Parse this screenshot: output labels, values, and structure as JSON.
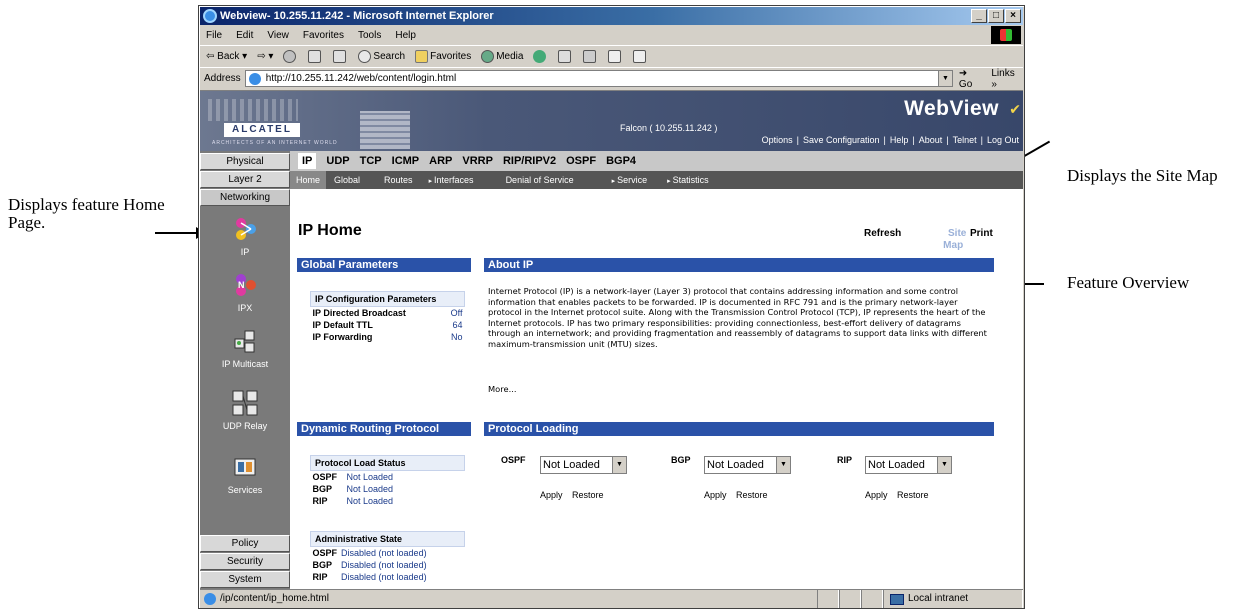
{
  "annotations": {
    "home_page": "Displays feature Home Page.",
    "site_map": "Displays the Site Map",
    "feature_overview": "Feature Overview"
  },
  "browser": {
    "title": "Webview- 10.255.11.242 - Microsoft Internet Explorer",
    "menu": [
      "File",
      "Edit",
      "View",
      "Favorites",
      "Tools",
      "Help"
    ],
    "toolbar": {
      "back": "Back",
      "search": "Search",
      "favorites": "Favorites",
      "media": "Media"
    },
    "address_label": "Address",
    "url": "http://10.255.11.242/web/content/login.html",
    "go": "Go",
    "links": "Links",
    "status_url": "/ip/content/ip_home.html",
    "status_zone": "Local intranet"
  },
  "banner": {
    "logo": "ALCATEL",
    "tagline": "ARCHITECTS OF AN INTERNET WORLD",
    "device": "Falcon  ( 10.255.11.242 )",
    "brand": "WebView",
    "links": [
      "Options",
      "Save Configuration",
      "Help",
      "About",
      "Telnet",
      "Log Out"
    ]
  },
  "leftnav": {
    "top_buttons": [
      "Physical",
      "Layer 2",
      "Networking"
    ],
    "items": [
      {
        "label": "IP",
        "icon": "ip-icon"
      },
      {
        "label": "IPX",
        "icon": "ipx-icon"
      },
      {
        "label": "IP Multicast",
        "icon": "ip-multicast-icon"
      },
      {
        "label": "UDP Relay",
        "icon": "udp-relay-icon"
      },
      {
        "label": "Services",
        "icon": "services-icon"
      }
    ],
    "bottom_buttons": [
      "Policy",
      "Security",
      "System"
    ]
  },
  "tabs": [
    "IP",
    "UDP",
    "TCP",
    "ICMP",
    "ARP",
    "VRRP",
    "RIP/RIPV2",
    "OSPF",
    "BGP4"
  ],
  "subnav": [
    "Home",
    "Global",
    "Routes",
    "Interfaces",
    "Denial of Service",
    "Service",
    "Statistics"
  ],
  "page": {
    "title": "IP Home",
    "refresh": "Refresh",
    "site_map": "Site Map",
    "site_label_1": "Site",
    "site_label_2": "Map",
    "print": "Print"
  },
  "global_parameters": {
    "header": "Global Parameters",
    "table_title": "IP Configuration Parameters",
    "rows": [
      {
        "label": "IP Directed Broadcast",
        "value": "Off"
      },
      {
        "label": "IP Default TTL",
        "value": "64"
      },
      {
        "label": "IP Forwarding",
        "value": "No"
      }
    ]
  },
  "about": {
    "header": "About IP",
    "text": "Internet Protocol (IP) is a network-layer (Layer 3) protocol that contains addressing information and some control information that enables packets to be forwarded. IP is documented in RFC 791 and is the primary network-layer protocol in the Internet protocol suite. Along with the Transmission Control Protocol (TCP), IP represents the heart of the Internet protocols. IP has two primary responsibilities: providing connectionless, best-effort delivery of datagrams through an internetwork; and providing fragmentation and reassembly of datagrams to support data links with different maximum-transmission unit (MTU) sizes.",
    "more": "More..."
  },
  "dynamic_routing": {
    "header": "Dynamic Routing Protocol",
    "load_status_title": "Protocol Load Status",
    "load_status": [
      {
        "label": "OSPF",
        "value": "Not Loaded"
      },
      {
        "label": "BGP",
        "value": "Not Loaded"
      },
      {
        "label": "RIP",
        "value": "Not Loaded"
      }
    ],
    "admin_state_title": "Administrative State",
    "admin_state": [
      {
        "label": "OSPF",
        "value": "Disabled (not loaded)"
      },
      {
        "label": "BGP",
        "value": "Disabled (not loaded)"
      },
      {
        "label": "RIP",
        "value": "Disabled (not loaded)"
      }
    ]
  },
  "protocol_loading": {
    "header": "Protocol Loading",
    "protocols": [
      {
        "label": "OSPF",
        "selected": "Not Loaded",
        "apply": "Apply",
        "restore": "Restore"
      },
      {
        "label": "BGP",
        "selected": "Not Loaded",
        "apply": "Apply",
        "restore": "Restore"
      },
      {
        "label": "RIP",
        "selected": "Not Loaded",
        "apply": "Apply",
        "restore": "Restore"
      }
    ]
  }
}
